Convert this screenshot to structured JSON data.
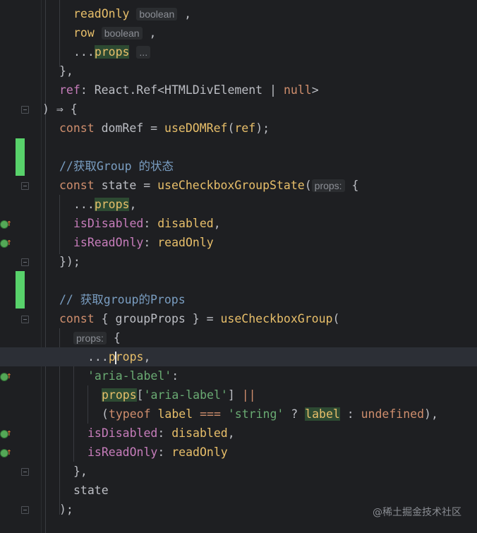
{
  "editor": {
    "lines": [
      {
        "tokens": [
          {
            "t": "readOnly",
            "c": "param"
          },
          {
            "t": " ",
            "c": "var"
          },
          {
            "t": "boolean",
            "c": "hint"
          },
          {
            "t": " ,",
            "c": "var"
          }
        ]
      },
      {
        "tokens": [
          {
            "t": "row",
            "c": "param"
          },
          {
            "t": " ",
            "c": "var"
          },
          {
            "t": "boolean",
            "c": "hint"
          },
          {
            "t": " ,",
            "c": "var"
          }
        ]
      },
      {
        "tokens": [
          {
            "t": "...",
            "c": "var"
          },
          {
            "t": "props",
            "c": "param-hl"
          },
          {
            "t": " ",
            "c": "var"
          },
          {
            "t": "...",
            "c": "hint"
          }
        ]
      },
      {
        "tokens": [
          {
            "t": "},",
            "c": "var"
          }
        ]
      },
      {
        "tokens": [
          {
            "t": "ref",
            "c": "prop"
          },
          {
            "t": ": ",
            "c": "var"
          },
          {
            "t": "React",
            "c": "var"
          },
          {
            "t": ".",
            "c": "var"
          },
          {
            "t": "Ref",
            "c": "var"
          },
          {
            "t": "<",
            "c": "var"
          },
          {
            "t": "HTMLDivElement",
            "c": "var"
          },
          {
            "t": " | ",
            "c": "var"
          },
          {
            "t": "null",
            "c": "kw"
          },
          {
            "t": ">",
            "c": "var"
          }
        ]
      },
      {
        "tokens": [
          {
            "t": ") ⇒ {",
            "c": "var"
          }
        ]
      },
      {
        "tokens": [
          {
            "t": "const ",
            "c": "kw"
          },
          {
            "t": "domRef",
            "c": "var"
          },
          {
            "t": " = ",
            "c": "var"
          },
          {
            "t": "useDOMRef",
            "c": "fnc"
          },
          {
            "t": "(",
            "c": "var"
          },
          {
            "t": "ref",
            "c": "param"
          },
          {
            "t": ");",
            "c": "var"
          }
        ]
      },
      {
        "tokens": []
      },
      {
        "tokens": [
          {
            "t": "//获取Group 的状态",
            "c": "cmt"
          }
        ]
      },
      {
        "tokens": [
          {
            "t": "const ",
            "c": "kw"
          },
          {
            "t": "state",
            "c": "var"
          },
          {
            "t": " = ",
            "c": "var"
          },
          {
            "t": "useCheckboxGroupState",
            "c": "fnc"
          },
          {
            "t": "(",
            "c": "var"
          },
          {
            "t": "props:",
            "c": "hint"
          },
          {
            "t": " {",
            "c": "var"
          }
        ]
      },
      {
        "tokens": [
          {
            "t": "...",
            "c": "var"
          },
          {
            "t": "props",
            "c": "param-hl"
          },
          {
            "t": ",",
            "c": "var"
          }
        ]
      },
      {
        "tokens": [
          {
            "t": "isDisabled",
            "c": "prop"
          },
          {
            "t": ": ",
            "c": "var"
          },
          {
            "t": "disabled",
            "c": "param"
          },
          {
            "t": ",",
            "c": "var"
          }
        ]
      },
      {
        "tokens": [
          {
            "t": "isReadOnly",
            "c": "prop"
          },
          {
            "t": ": ",
            "c": "var"
          },
          {
            "t": "readOnly",
            "c": "param"
          }
        ]
      },
      {
        "tokens": [
          {
            "t": "});",
            "c": "var"
          }
        ]
      },
      {
        "tokens": []
      },
      {
        "tokens": [
          {
            "t": "// 获取group的Props",
            "c": "cmt"
          }
        ]
      },
      {
        "tokens": [
          {
            "t": "const ",
            "c": "kw"
          },
          {
            "t": "{ groupProps }",
            "c": "var"
          },
          {
            "t": " = ",
            "c": "var"
          },
          {
            "t": "useCheckboxGroup",
            "c": "fnc"
          },
          {
            "t": "(",
            "c": "var"
          }
        ]
      },
      {
        "tokens": [
          {
            "t": "props:",
            "c": "hint"
          },
          {
            "t": " {",
            "c": "var"
          }
        ]
      },
      {
        "tokens": [
          {
            "t": "...",
            "c": "var"
          },
          {
            "t": "p",
            "c": "param"
          },
          {
            "t": "CARET",
            "c": "caret"
          },
          {
            "t": "rops",
            "c": "param"
          },
          {
            "t": ",",
            "c": "var"
          }
        ]
      },
      {
        "tokens": [
          {
            "t": "'aria-label'",
            "c": "str"
          },
          {
            "t": ":",
            "c": "var"
          }
        ]
      },
      {
        "tokens": [
          {
            "t": "props",
            "c": "param-hl"
          },
          {
            "t": "[",
            "c": "var"
          },
          {
            "t": "'aria-label'",
            "c": "str"
          },
          {
            "t": "] ",
            "c": "var"
          },
          {
            "t": "||",
            "c": "kw"
          }
        ]
      },
      {
        "tokens": [
          {
            "t": "(",
            "c": "var"
          },
          {
            "t": "typeof ",
            "c": "kw"
          },
          {
            "t": "label",
            "c": "param"
          },
          {
            "t": " ",
            "c": "var"
          },
          {
            "t": "===",
            "c": "kw"
          },
          {
            "t": " ",
            "c": "var"
          },
          {
            "t": "'string'",
            "c": "str"
          },
          {
            "t": " ? ",
            "c": "var"
          },
          {
            "t": "label",
            "c": "param-hl"
          },
          {
            "t": " : ",
            "c": "var"
          },
          {
            "t": "undefined",
            "c": "kw"
          },
          {
            "t": "),",
            "c": "var"
          }
        ]
      },
      {
        "tokens": [
          {
            "t": "isDisabled",
            "c": "prop"
          },
          {
            "t": ": ",
            "c": "var"
          },
          {
            "t": "disabled",
            "c": "param"
          },
          {
            "t": ",",
            "c": "var"
          }
        ]
      },
      {
        "tokens": [
          {
            "t": "isReadOnly",
            "c": "prop"
          },
          {
            "t": ": ",
            "c": "var"
          },
          {
            "t": "readOnly",
            "c": "param"
          }
        ]
      },
      {
        "tokens": [
          {
            "t": "},",
            "c": "var"
          }
        ]
      },
      {
        "tokens": [
          {
            "t": "state",
            "c": "var"
          }
        ]
      },
      {
        "tokens": [
          {
            "t": ");",
            "c": "var"
          }
        ]
      }
    ]
  },
  "watermark": "@稀土掘金技术社区",
  "colors": {
    "background": "#1e1f22",
    "keyword": "#cf8e6d",
    "function": "#e8bf6a",
    "property": "#c77dbb",
    "string": "#6aab73",
    "comment": "#7a9ec2",
    "change_bar": "#58d26b"
  }
}
